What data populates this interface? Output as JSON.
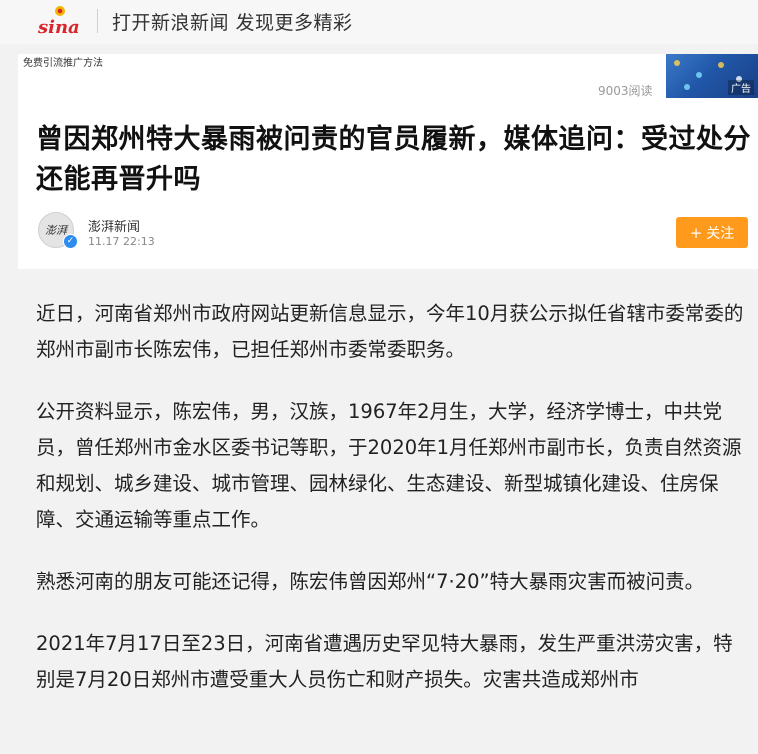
{
  "topbar": {
    "logo_alt": "sina",
    "promo_text": "打开新浪新闻 发现更多精彩"
  },
  "ad": {
    "label": "免费引流推广方法",
    "badge": "广告"
  },
  "article_meta": {
    "reads": "9003阅读",
    "title": "曾因郑州特大暴雨被问责的官员履新，媒体追问：受过处分还能再晋升吗",
    "source": "澎湃新闻",
    "avatar_text": "澎湃",
    "time": "11.17  22:13",
    "follow_label": "关注",
    "follow_icon": "+"
  },
  "paragraphs": [
    "近日，河南省郑州市政府网站更新信息显示，今年10月获公示拟任省辖市委常委的郑州市副市长陈宏伟，已担任郑州市委常委职务。",
    "公开资料显示，陈宏伟，男，汉族，1967年2月生，大学，经济学博士，中共党员，曾任郑州市金水区委书记等职，于2020年1月任郑州市副市长，负责自然资源和规划、城乡建设、城市管理、园林绿化、生态建设、新型城镇化建设、住房保障、交通运输等重点工作。",
    "熟悉河南的朋友可能还记得，陈宏伟曾因郑州“7·20”特大暴雨灾害而被问责。",
    "2021年7月17日至23日，河南省遭遇历史罕见特大暴雨，发生严重洪涝灾害，特别是7月20日郑州市遭受重大人员伤亡和财产损失。灾害共造成郑州市"
  ],
  "colors": {
    "accent": "#ff9a1c",
    "verified": "#2d8cf0",
    "logo_red": "#d9262c"
  }
}
